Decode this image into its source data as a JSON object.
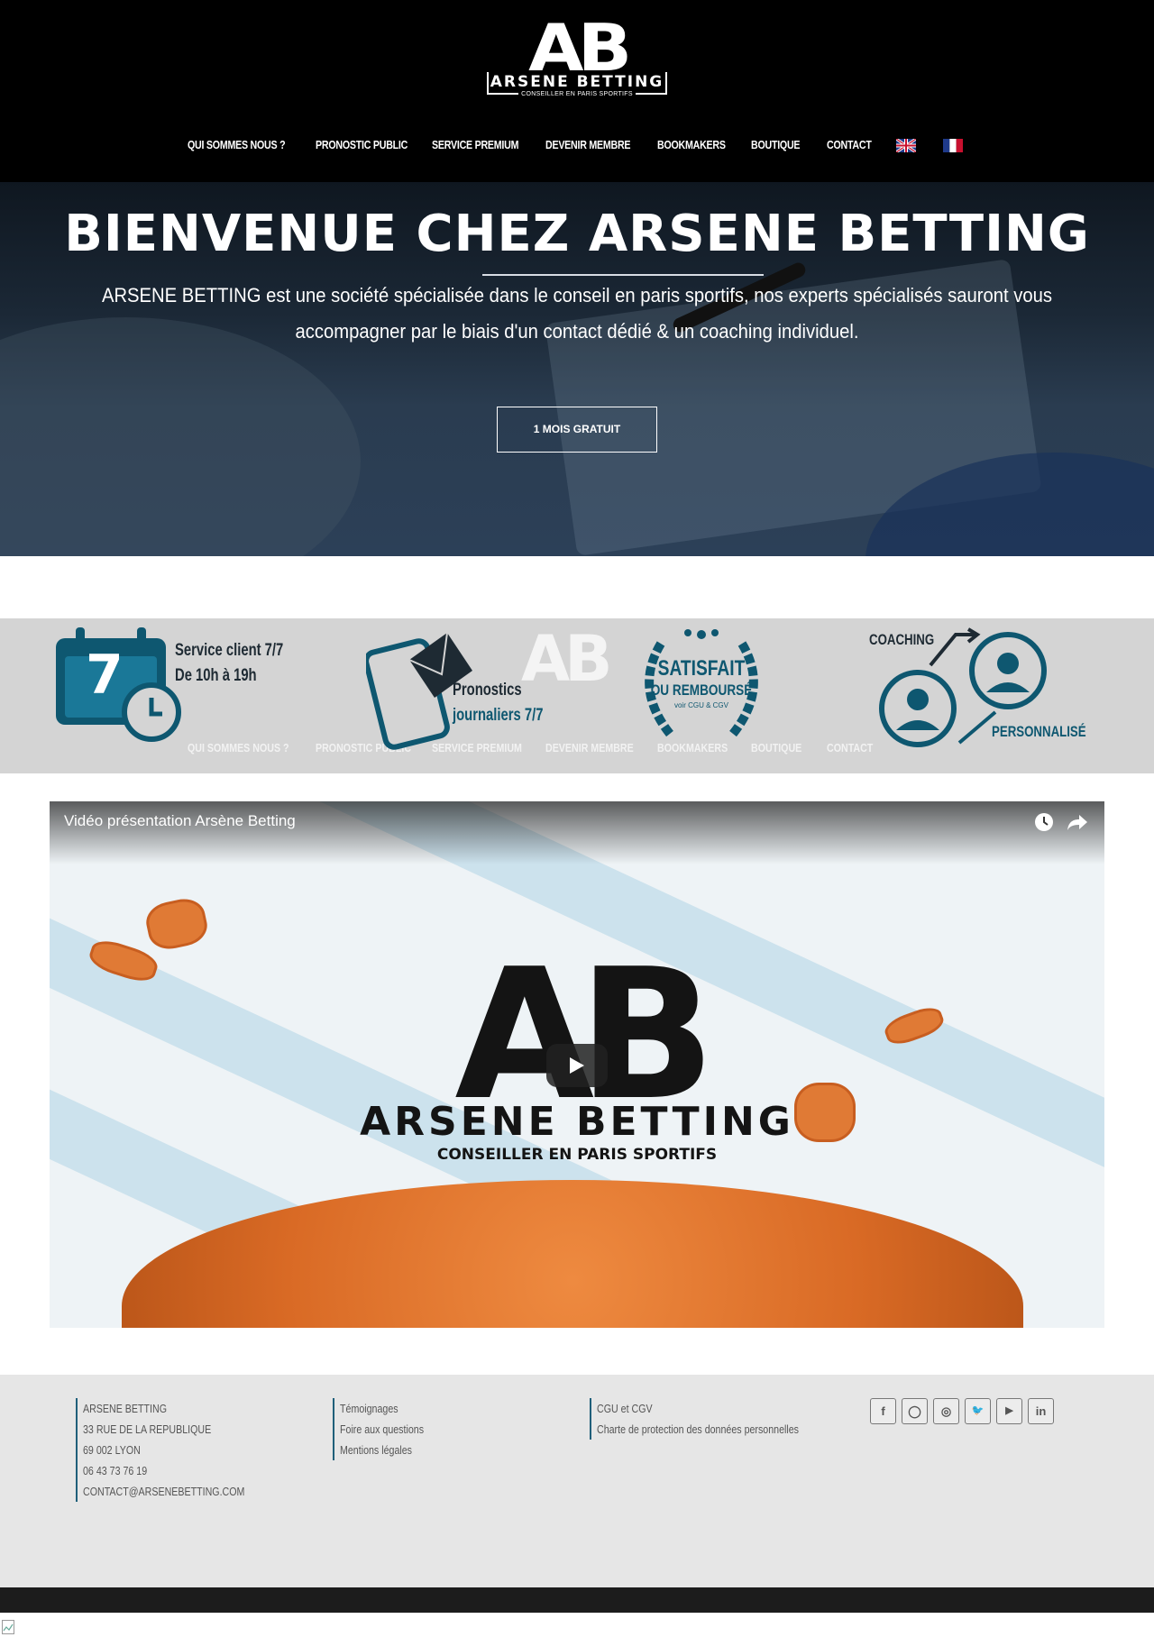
{
  "brand": {
    "logo_mark": "AB",
    "logo_name": "ARSENE BETTING",
    "logo_tagline": "CONSEILLER EN PARIS SPORTIFS"
  },
  "nav": {
    "items": [
      {
        "label": "QUI SOMMES NOUS ?"
      },
      {
        "label": "PRONOSTIC PUBLIC"
      },
      {
        "label": "SERVICE PREMIUM"
      },
      {
        "label": "DEVENIR MEMBRE"
      },
      {
        "label": "BOOKMAKERS"
      },
      {
        "label": "BOUTIQUE"
      },
      {
        "label": "CONTACT"
      }
    ],
    "flags": [
      "uk-flag-icon",
      "fr-flag-icon"
    ]
  },
  "hero": {
    "title": "BIENVENUE CHEZ ARSENE BETTING",
    "text": "ARSENE BETTING est une société spécialisée dans le conseil en paris sportifs, nos experts spécialisés sauront vous accompagner par le biais d'un contact dédié & un coaching individuel.",
    "cta_label": "1 MOIS GRATUIT"
  },
  "features": {
    "service_line1": "Service client 7/7",
    "service_line2": "De 10h à 19h",
    "calendar_day": "7",
    "prono_line1": "Pronostics",
    "prono_line2": "journaliers 7/7",
    "satisfait_line1": "SATISFAIT",
    "satisfait_line2": "OU REMBOURSÉ",
    "satisfait_line3": "voir CGU & CGV",
    "coaching_label": "COACHING",
    "personnalise_label": "PERSONNALISÉ"
  },
  "video": {
    "title": "Vidéo présentation Arsène Betting",
    "logo_mark": "AB",
    "logo_name": "ARSENE BETTING",
    "logo_tagline": "CONSEILLER EN PARIS SPORTIFS",
    "icons": [
      "clock-icon",
      "share-icon",
      "play-icon"
    ]
  },
  "footer": {
    "contact": [
      "ARSENE BETTING",
      "33 RUE DE LA REPUBLIQUE",
      "69 002 LYON",
      "06 43 73 76 19",
      "CONTACT@ARSENEBETTING.COM"
    ],
    "links1": [
      "Témoignages",
      "Foire aux questions",
      "Mentions légales"
    ],
    "links2": [
      "CGU et CGV",
      "Charte de protection des données personnelles"
    ],
    "social": [
      {
        "icon": "facebook-icon",
        "glyph": "f"
      },
      {
        "icon": "messenger-icon",
        "glyph": "◯"
      },
      {
        "icon": "instagram-icon",
        "glyph": "◎"
      },
      {
        "icon": "twitter-icon",
        "glyph": "🐦"
      },
      {
        "icon": "youtube-icon",
        "glyph": "▶"
      },
      {
        "icon": "linkedin-icon",
        "glyph": "in"
      }
    ]
  },
  "colors": {
    "header_bg": "#000000",
    "hero_overlay": "#2c4058",
    "features_bg": "#d4d4d4",
    "accent_teal": "#0e5770",
    "footer_bg": "#e6e6e6",
    "bottom_bar": "#1c1c1c"
  }
}
